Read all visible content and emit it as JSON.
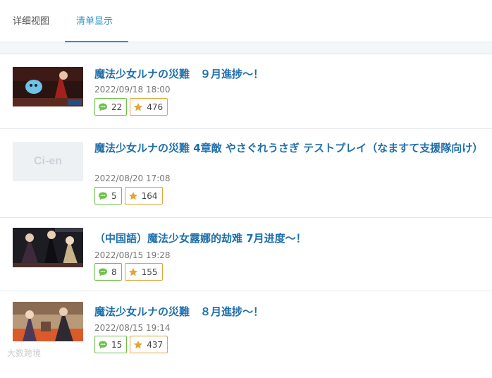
{
  "tabs": [
    {
      "label": "详细视图"
    },
    {
      "label": "清单显示"
    }
  ],
  "posts": [
    {
      "title": "魔法少女ルナの災難　９月進捗～！",
      "date": "2022/09/18 18:00",
      "comments": "22",
      "stars": "476",
      "thumb": "scene-dark-red"
    },
    {
      "title": "魔法少女ルナの災難 4章敵 やさぐれうさぎ テストプレイ（なますて支援隊向け）",
      "date": "2022/08/20 17:08",
      "comments": "5",
      "stars": "164",
      "thumb": "ci-en-placeholder",
      "thumb_text": "Ci-en"
    },
    {
      "title": "（中国語）魔法少女露娜的劫难 7月进度～！",
      "date": "2022/08/15 19:28",
      "comments": "8",
      "stars": "155",
      "thumb": "scene-dark-characters"
    },
    {
      "title": "魔法少女ルナの災難　８月進捗～！",
      "date": "2022/08/15 19:14",
      "comments": "15",
      "stars": "437",
      "thumb": "scene-room-characters"
    }
  ],
  "icons": {
    "comment": "speech-bubble-icon",
    "star": "star-icon"
  },
  "colors": {
    "accent": "#2a93c9",
    "title": "#1f6fab",
    "comment_border": "#6cc24a",
    "star": "#e3a53a"
  },
  "watermark": "大数跨境"
}
